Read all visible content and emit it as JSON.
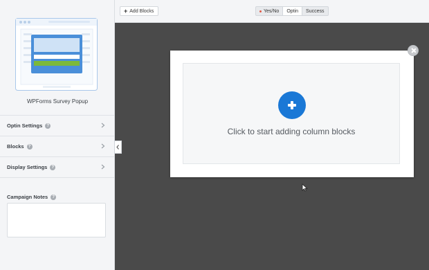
{
  "sidebar": {
    "campaign_name": "WPForms Survey Popup",
    "settings": [
      {
        "label": "Optin Settings",
        "icon": "chevron-right-icon"
      },
      {
        "label": "Blocks",
        "icon": "chevron-right-icon"
      },
      {
        "label": "Display Settings",
        "icon": "chevron-right-icon"
      }
    ],
    "notes_label": "Campaign Notes",
    "notes_value": "",
    "help_glyph": "?"
  },
  "toolbar": {
    "add_blocks_label": "Add Blocks",
    "view_tabs": [
      {
        "label": "Yes/No",
        "active": false
      },
      {
        "label": "Optin",
        "active": true
      },
      {
        "label": "Success",
        "active": false
      }
    ]
  },
  "canvas": {
    "column_prompt": "Click to start adding column blocks"
  },
  "colors": {
    "accent": "#1a78d6",
    "canvas_bg": "#4a4a4a",
    "preview_green": "#7cb93a",
    "status_dot": "#e05a47"
  }
}
